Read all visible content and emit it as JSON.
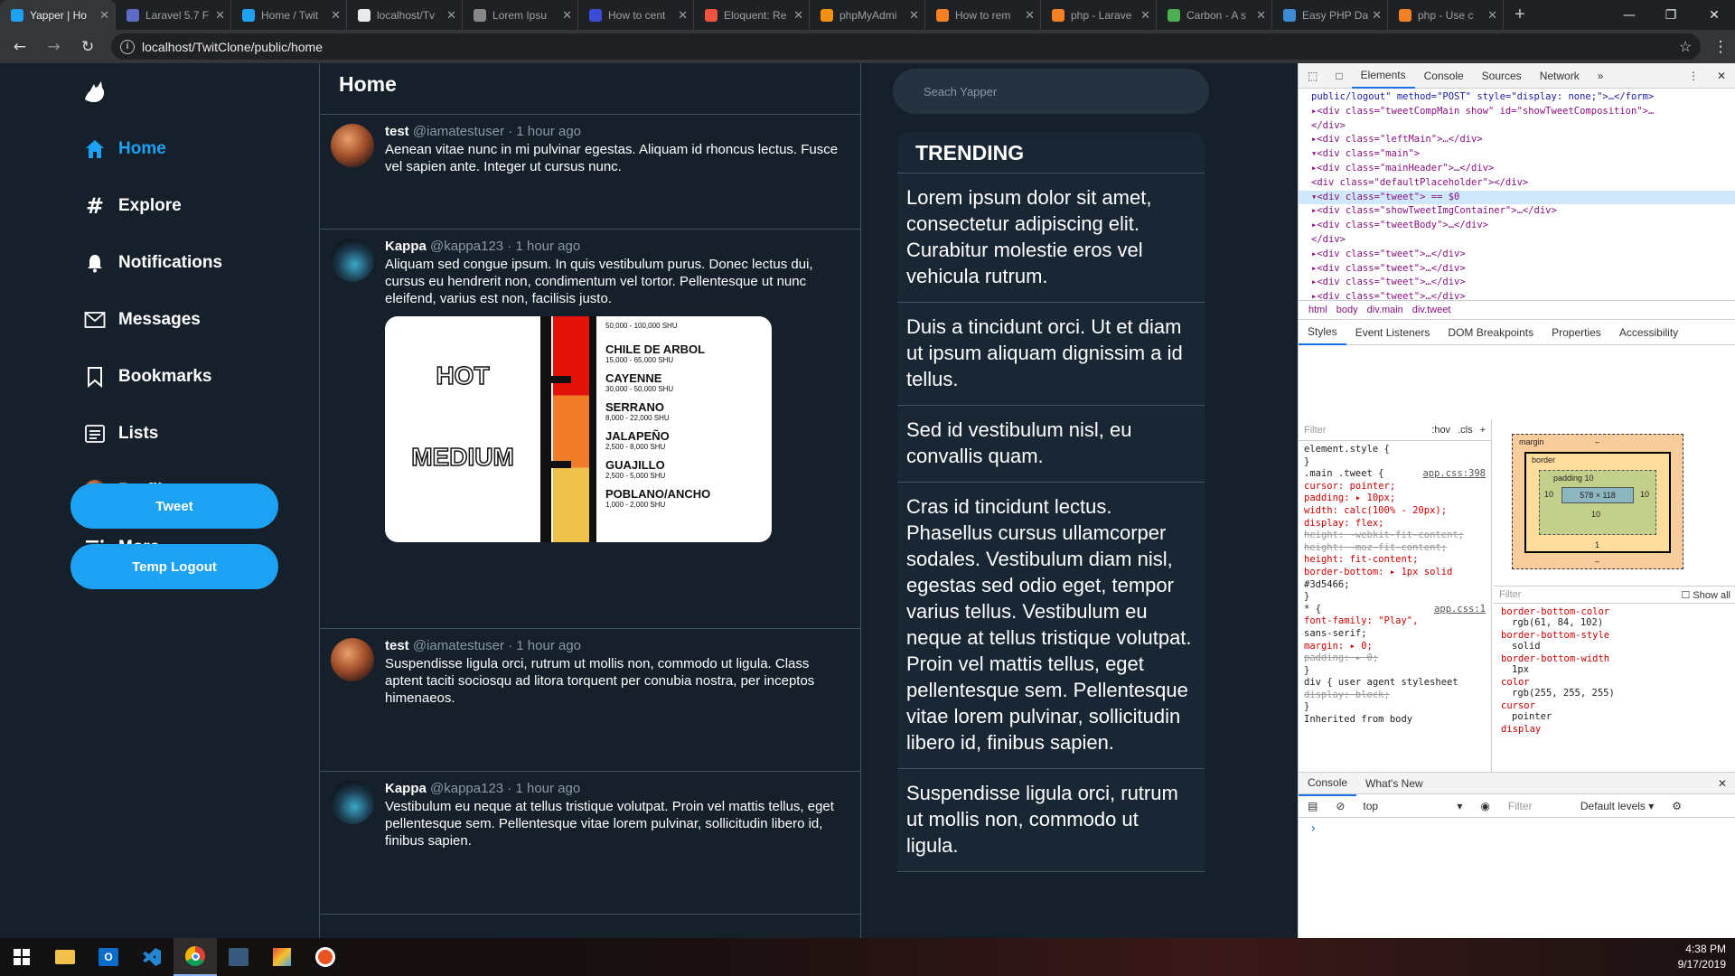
{
  "browser": {
    "tabs": [
      {
        "label": "Yapper | Ho",
        "color": "#1da1f2",
        "active": true
      },
      {
        "label": "Laravel 5.7 F",
        "color": "#5f6cc6"
      },
      {
        "label": "Home / Twit",
        "color": "#1da1f2"
      },
      {
        "label": "localhost/Tv",
        "color": "#e8eaed"
      },
      {
        "label": "Lorem Ipsu",
        "color": "#888888"
      },
      {
        "label": "How to cent",
        "color": "#3c4bd6"
      },
      {
        "label": "Eloquent: Re",
        "color": "#f05340"
      },
      {
        "label": "phpMyAdmi",
        "color": "#f29111"
      },
      {
        "label": "How to rem",
        "color": "#f48024"
      },
      {
        "label": "php - Larave",
        "color": "#f48024"
      },
      {
        "label": "Carbon - A s",
        "color": "#4caf50"
      },
      {
        "label": "Easy PHP Da",
        "color": "#3c8dd6"
      },
      {
        "label": "php - Use c",
        "color": "#f48024"
      }
    ],
    "newtab": "+",
    "url": "localhost/TwitClone/public/home"
  },
  "sidebar": {
    "nav": [
      {
        "label": "Home",
        "icon": "home-icon",
        "active": true
      },
      {
        "label": "Explore",
        "icon": "hash-icon"
      },
      {
        "label": "Notifications",
        "icon": "bell-icon"
      },
      {
        "label": "Messages",
        "icon": "envelope-icon"
      },
      {
        "label": "Bookmarks",
        "icon": "bookmark-icon"
      },
      {
        "label": "Lists",
        "icon": "list-icon"
      },
      {
        "label": "Profile",
        "icon": "avatar"
      },
      {
        "label": "More",
        "icon": "more-icon"
      }
    ],
    "tweet_button": "Tweet",
    "logout_button": "Temp Logout"
  },
  "feed": {
    "title": "Home",
    "tweets": [
      {
        "name": "test",
        "handle": "@iamatestuser · 1 hour ago",
        "text": "Aenean vitae nunc in mi pulvinar egestas. Aliquam id rhoncus lectus. Fusce vel sapien ante. Integer ut cursus nunc."
      },
      {
        "name": "Kappa",
        "handle": "@kappa123 · 1 hour ago",
        "text": "Aliquam sed congue ipsum. In quis vestibulum purus. Donec lectus dui, cursus eu hendrerit non, condimentum vel tortor. Pellentesque ut nunc eleifend, varius est non, facilisis justo."
      },
      {
        "name": "test",
        "handle": "@iamatestuser · 1 hour ago",
        "text": "Suspendisse ligula orci, rutrum ut mollis non, commodo ut ligula. Class aptent taciti sociosqu ad litora torquent per conubia nostra, per inceptos himenaeos."
      },
      {
        "name": "Kappa",
        "handle": "@kappa123 · 1 hour ago",
        "text": "Vestibulum eu neque at tellus tristique volutpat. Proin vel mattis tellus, eget pellentesque sem. Pellentesque vitae lorem pulvinar, sollicitudin libero id, finibus sapien."
      }
    ],
    "image": {
      "scale_labels": [
        "HOT",
        "MEDIUM"
      ],
      "peppers": [
        {
          "name": "CHILE DE ARBOL",
          "shu": "15,000 - 65,000 SHU"
        },
        {
          "name": "CAYENNE",
          "shu": "30,000 - 50,000 SHU"
        },
        {
          "name": "SERRANO",
          "shu": "8,000 - 22,000 SHU"
        },
        {
          "name": "JALAPEÑO",
          "shu": "2,500 - 8,000 SHU"
        },
        {
          "name": "GUAJILLO",
          "shu": "2,500 - 5,000 SHU"
        },
        {
          "name": "POBLANO/ANCHO",
          "shu": "1,000 - 2,000 SHU"
        }
      ],
      "top_partial_shu": "50,000 - 100,000 SHU"
    }
  },
  "right": {
    "search_placeholder": "Seach Yapper",
    "trending_title": "TRENDING",
    "trends": [
      "Lorem ipsum dolor sit amet, consectetur adipiscing elit. Curabitur molestie eros vel vehicula rutrum.",
      "Duis a tincidunt orci. Ut et diam ut ipsum aliquam dignissim a id tellus.",
      "Sed id vestibulum nisl, eu convallis quam.",
      "Cras id tincidunt lectus. Phasellus cursus ullamcorper sodales. Vestibulum diam nisl, egestas sed odio eget, tempor varius tellus. Vestibulum eu neque at tellus tristique volutpat. Proin vel mattis tellus, eget pellentesque sem. Pellentesque vitae lorem pulvinar, sollicitudin libero id, finibus sapien.",
      "Suspendisse ligula orci, rutrum ut mollis non, commodo ut ligula."
    ]
  },
  "devtools": {
    "tabs": [
      "Elements",
      "Console",
      "Sources",
      "Network"
    ],
    "dom_lines": [
      "public/logout\" method=\"POST\" style=\"display: none;\">…</form>",
      "▸<div class=\"tweetCompMain show\" id=\"showTweetComposition\">…",
      "</div>",
      "▸<div class=\"leftMain\">…</div>",
      "▾<div class=\"main\">",
      "  ▸<div class=\"mainHeader\">…</div>",
      "   <div class=\"defaultPlaceholder\"></div>",
      "  ▾<div class=\"tweet\"> == $0",
      "    ▸<div class=\"showTweetImgContainer\">…</div>",
      "    ▸<div class=\"tweetBody\">…</div>",
      "   </div>",
      "  ▸<div class=\"tweet\">…</div>",
      "  ▸<div class=\"tweet\">…</div>",
      "  ▸<div class=\"tweet\">…</div>",
      "  ▸<div class=\"tweet\">…</div>"
    ],
    "crumbs": [
      "html",
      "body",
      "div.main",
      "div.tweet"
    ],
    "subtabs": [
      "Styles",
      "Event Listeners",
      "DOM Breakpoints",
      "Properties",
      "Accessibility"
    ],
    "filter": "Filter",
    "hov": ":hov",
    "cls": ".cls",
    "style_lines": [
      "element.style {",
      "}",
      ".main .tweet {",
      "  cursor: pointer;",
      "  padding: ▸ 10px;",
      "  width: calc(100% - 20px);",
      "  display: flex;",
      "  height: -webkit-fit-content;",
      "  height: -moz-fit-content;",
      "  height: fit-content;",
      "  border-bottom: ▸ 1px solid",
      "      #3d5466;",
      "}",
      "* {",
      "  font-family: \"Play\",",
      "      sans-serif;",
      "  margin: ▸ 0;",
      "  padding: ▸ 0;",
      "}",
      "div {   user agent stylesheet",
      "  display: block;",
      "}",
      "Inherited from body"
    ],
    "style_file1": "app.css:398",
    "style_file2": "app.css:1",
    "boxmodel": {
      "margin": "margin",
      "border": "border",
      "padding": "padding 10",
      "content": "578 × 118",
      "dash": "–",
      "pad": "10",
      "one": "1"
    },
    "computed_filter": "Filter",
    "show_all": "Show all",
    "computed": [
      {
        "prop": "border-bottom-color",
        "val": "rgb(61, 84, 102)"
      },
      {
        "prop": "border-bottom-style",
        "val": "solid"
      },
      {
        "prop": "border-bottom-width",
        "val": "1px"
      },
      {
        "prop": "color",
        "val": "rgb(255, 255, 255)"
      },
      {
        "prop": "cursor",
        "val": "pointer"
      },
      {
        "prop": "display",
        "val": ""
      }
    ],
    "drawer_tabs": [
      "Console",
      "What's New"
    ],
    "context": "top",
    "console_filter": "Filter",
    "levels": "Default levels ▾",
    "prompt": "›"
  },
  "taskbar": {
    "time": "4:38 PM",
    "date": "9/17/2019"
  }
}
